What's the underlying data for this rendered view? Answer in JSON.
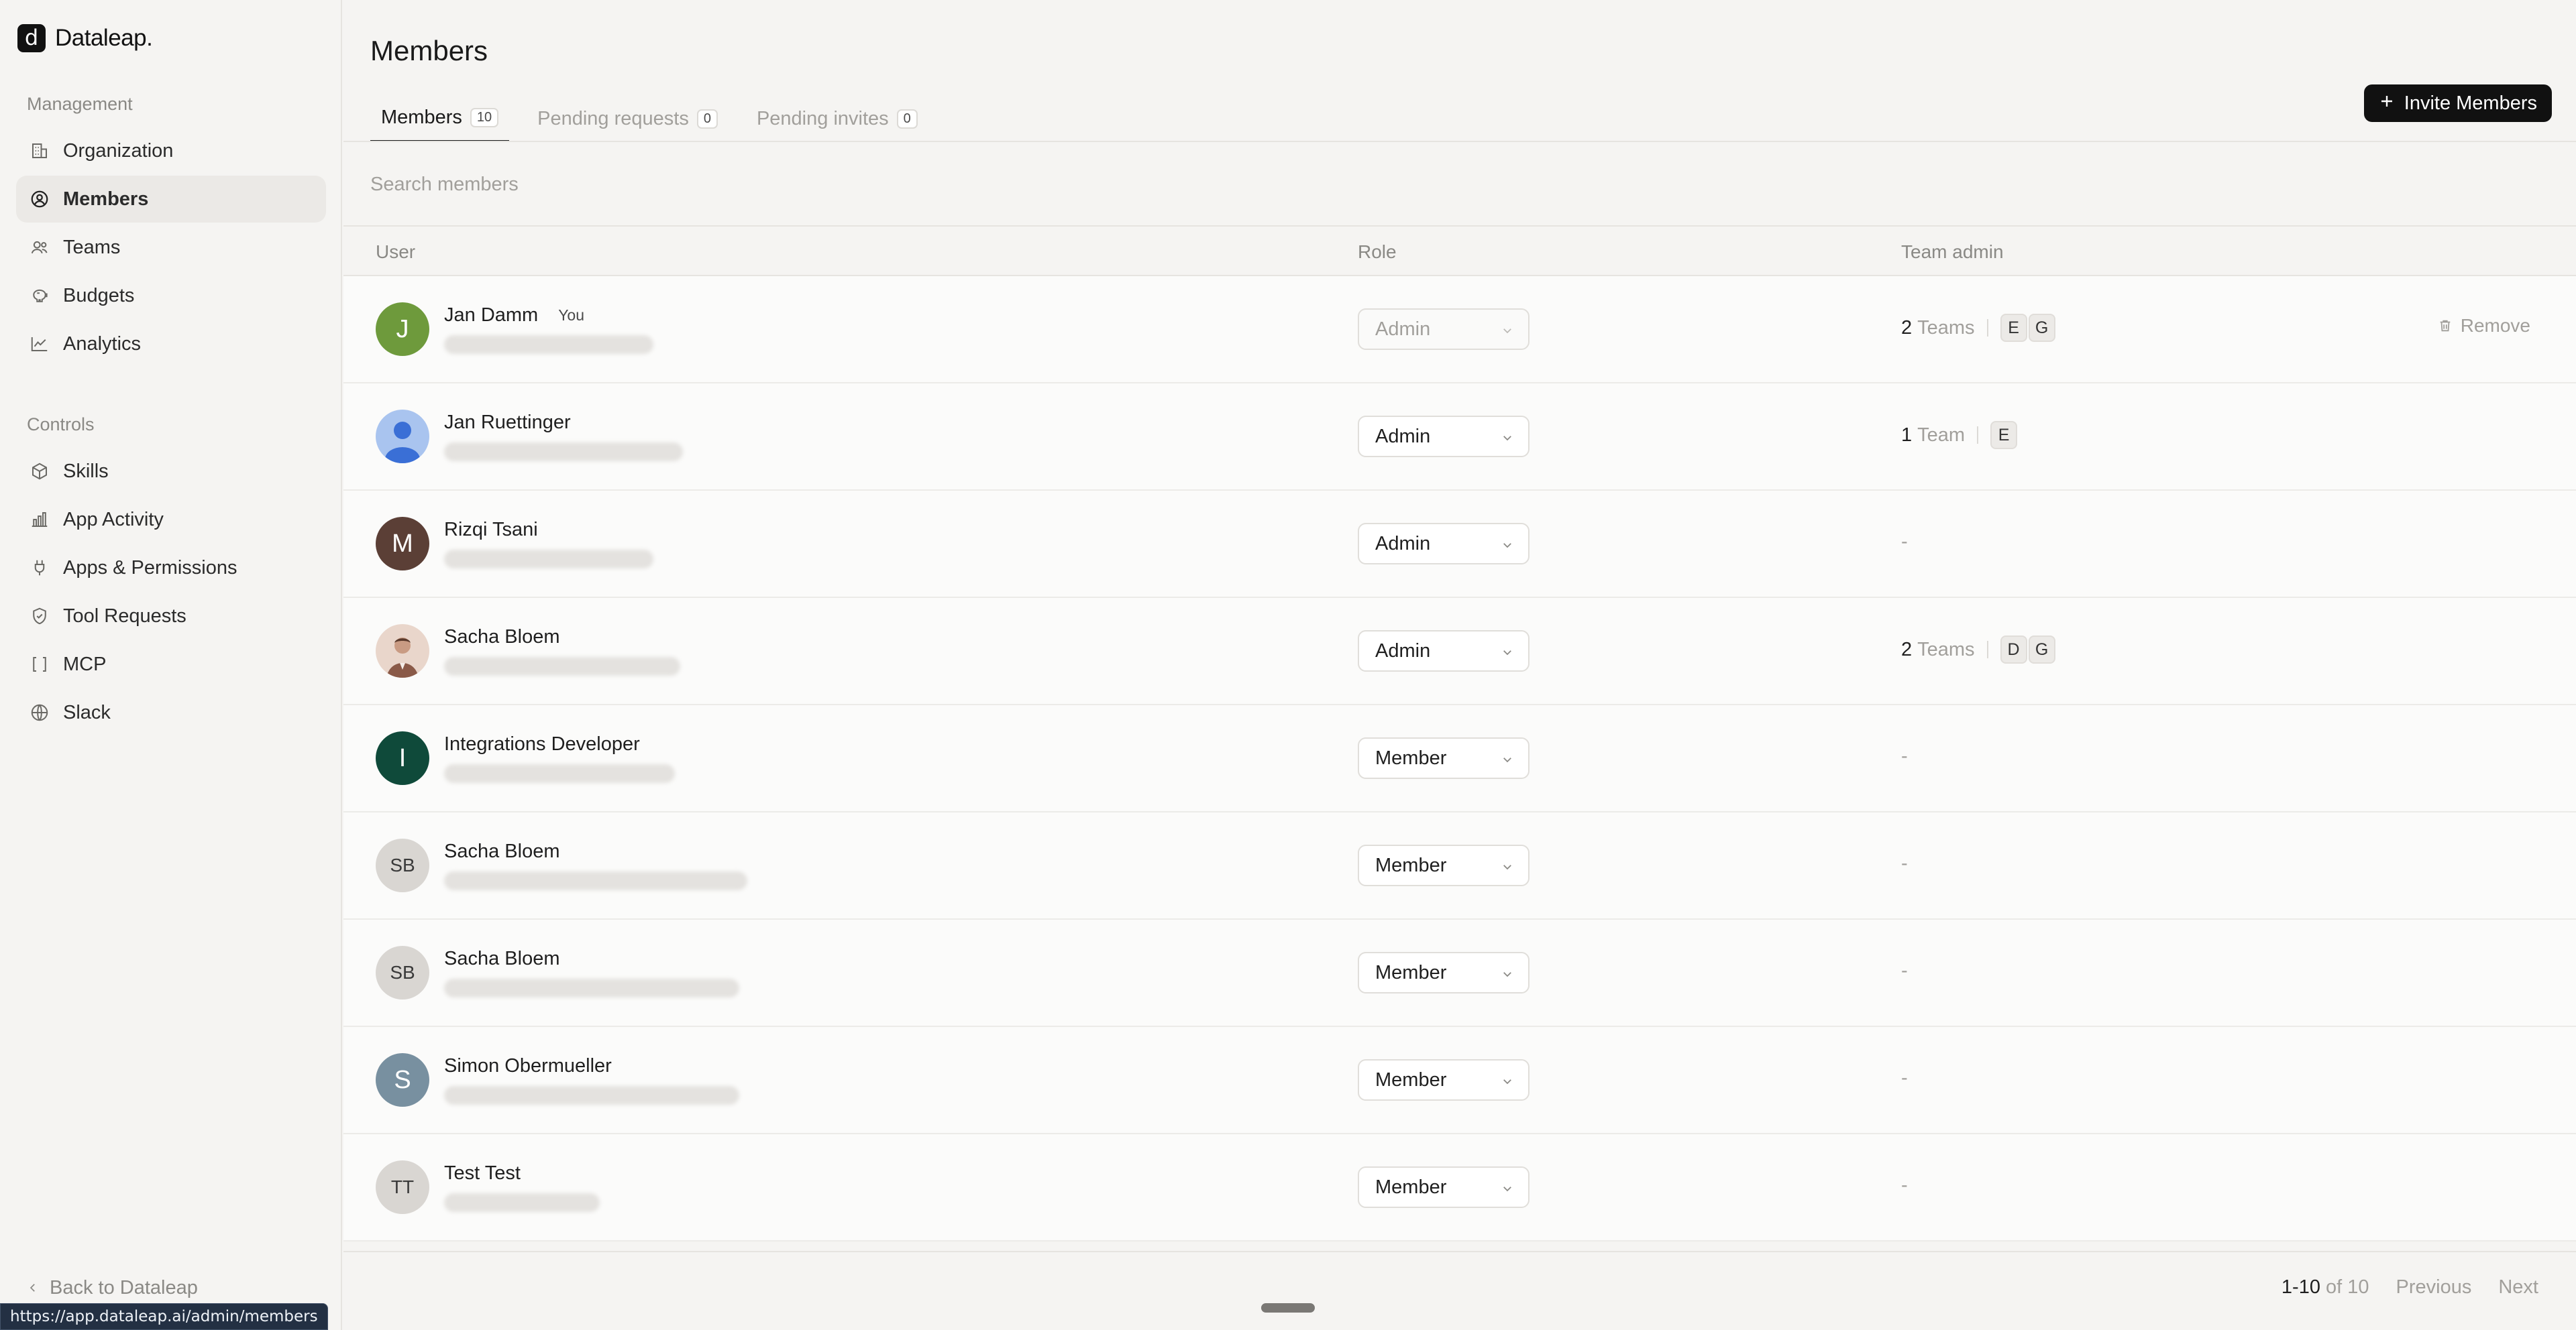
{
  "brand": {
    "mark": "d",
    "name": "Dataleap."
  },
  "sidebar": {
    "management_label": "Management",
    "management": [
      {
        "label": "Organization",
        "icon": "building-icon"
      },
      {
        "label": "Members",
        "icon": "user-circle-icon",
        "active": true
      },
      {
        "label": "Teams",
        "icon": "users-icon"
      },
      {
        "label": "Budgets",
        "icon": "piggy-bank-icon"
      },
      {
        "label": "Analytics",
        "icon": "line-chart-icon"
      }
    ],
    "controls_label": "Controls",
    "controls": [
      {
        "label": "Skills",
        "icon": "cube-icon"
      },
      {
        "label": "App Activity",
        "icon": "bar-chart-icon"
      },
      {
        "label": "Apps & Permissions",
        "icon": "plug-icon"
      },
      {
        "label": "Tool Requests",
        "icon": "shield-check-icon"
      },
      {
        "label": "MCP",
        "icon": "brackets-icon"
      },
      {
        "label": "Slack",
        "icon": "globe-icon"
      }
    ],
    "back_label": "Back to Dataleap"
  },
  "status_url": "https://app.dataleap.ai/admin/members",
  "page": {
    "title": "Members"
  },
  "tabs": [
    {
      "label": "Members",
      "count": "10",
      "active": true
    },
    {
      "label": "Pending requests",
      "count": "0"
    },
    {
      "label": "Pending invites",
      "count": "0"
    }
  ],
  "invite_button": "Invite Members",
  "search": {
    "placeholder": "Search members",
    "value": ""
  },
  "table": {
    "headers": {
      "user": "User",
      "role": "Role",
      "team_admin": "Team admin"
    },
    "rows": [
      {
        "name": "Jan Damm",
        "you": "You",
        "avatar": "J",
        "avatar_color": "#6e9a3c",
        "role": "Admin",
        "role_disabled": true,
        "team_count": "2",
        "team_label": "Teams",
        "team_chips": [
          "E",
          "G"
        ],
        "remove": "Remove"
      },
      {
        "name": "Jan Ruettinger",
        "avatar": "",
        "avatar_color": "#a9c4ef",
        "role": "Admin",
        "team_count": "1",
        "team_label": "Team",
        "team_chips": [
          "E"
        ]
      },
      {
        "name": "Rizqi Tsani",
        "avatar": "M",
        "avatar_color": "#5b3f36",
        "role": "Admin",
        "team_admin": "-"
      },
      {
        "name": "Sacha Bloem",
        "avatar": "",
        "avatar_color": "#e9d6cb",
        "role": "Admin",
        "team_count": "2",
        "team_label": "Teams",
        "team_chips": [
          "D",
          "G"
        ]
      },
      {
        "name": "Integrations Developer",
        "avatar": "I",
        "avatar_color": "#0f4a3a",
        "role": "Member",
        "team_admin": "-"
      },
      {
        "name": "Sacha Bloem",
        "avatar": "SB",
        "avatar_color": "#d9d6d2",
        "role": "Member",
        "team_admin": "-"
      },
      {
        "name": "Sacha Bloem",
        "avatar": "SB",
        "avatar_color": "#d9d6d2",
        "role": "Member",
        "team_admin": "-"
      },
      {
        "name": "Simon Obermueller",
        "avatar": "S",
        "avatar_color": "#7890a0",
        "role": "Member",
        "team_admin": "-"
      },
      {
        "name": "Test Test",
        "avatar": "TT",
        "avatar_color": "#d9d6d2",
        "role": "Member",
        "team_admin": "-"
      }
    ]
  },
  "pagination": {
    "range": "1-10",
    "of_label": "of 10",
    "previous": "Previous",
    "next": "Next"
  }
}
